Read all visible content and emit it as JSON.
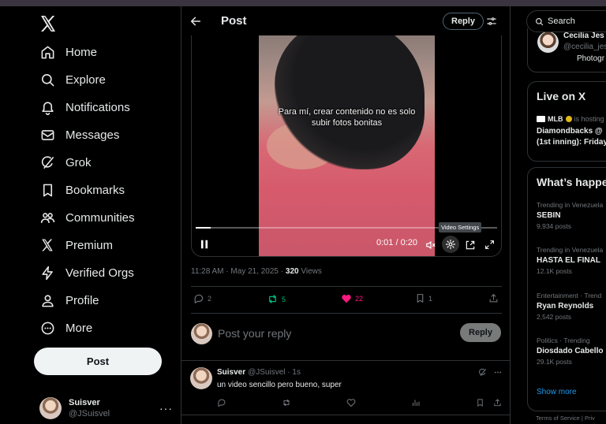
{
  "nav": {
    "items": [
      {
        "label": "Home",
        "icon": "home-icon"
      },
      {
        "label": "Explore",
        "icon": "search-icon"
      },
      {
        "label": "Notifications",
        "icon": "bell-icon"
      },
      {
        "label": "Messages",
        "icon": "envelope-icon"
      },
      {
        "label": "Grok",
        "icon": "grok-icon"
      },
      {
        "label": "Bookmarks",
        "icon": "bookmark-icon"
      },
      {
        "label": "Communities",
        "icon": "people-icon"
      },
      {
        "label": "Premium",
        "icon": "x-logo-icon"
      },
      {
        "label": "Verified Orgs",
        "icon": "lightning-icon"
      },
      {
        "label": "Profile",
        "icon": "person-icon"
      },
      {
        "label": "More",
        "icon": "more-circle-icon"
      }
    ],
    "post_label": "Post",
    "account": {
      "name": "Suisver",
      "handle": "@JSuisvel",
      "menu": "···"
    }
  },
  "header": {
    "title": "Post",
    "reply_label": "Reply"
  },
  "video": {
    "caption_line1": "Para mí, crear contenido no es solo",
    "caption_line2": "subir fotos bonitas",
    "time": "0:01 / 0:20",
    "tooltip": "Video Settings",
    "progress": 0.05
  },
  "post_meta": {
    "time": "11:28 AM · May 21, 2025 · ",
    "views_count": "320",
    "views_label": " Views"
  },
  "actions": {
    "replies": "2",
    "reposts": "5",
    "likes": "22",
    "bookmarks": "1"
  },
  "compose": {
    "placeholder": "Post your reply",
    "button": "Reply"
  },
  "reply": {
    "name": "Suisver",
    "handle": "@JSuisvel · 1s",
    "text": "un video sencillo pero bueno, super"
  },
  "right": {
    "search_placeholder": "Search",
    "suggest": {
      "name": "Cecilia Jes",
      "handle": "@cecilia_jes",
      "extra": "Photogr"
    },
    "live": {
      "title": "Live on X",
      "host": "MLB",
      "host_suffix": " is hosting",
      "line1": "Diamondbacks @",
      "line2": "(1st inning): Friday"
    },
    "trends_title": "What’s happe",
    "trends": [
      {
        "context": "Trending in Venezuela",
        "name": "SEBIN",
        "count": "9,934 posts"
      },
      {
        "context": "Trending in Venezuela",
        "name": "HASTA EL FINAL",
        "count": "12.1K posts"
      },
      {
        "context": "Entertainment · Trend",
        "name": "Ryan Reynolds",
        "count": "2,542 posts"
      },
      {
        "context": "Politics · Trending",
        "name": "Diosdado Cabello",
        "count": "29.1K posts"
      }
    ],
    "show_more": "Show more",
    "footer": "Terms of Service  |  Priv"
  },
  "colors": {
    "accent": "#1d9bf0",
    "like": "#f91880",
    "repost": "#00ba7c",
    "border": "#2f3336"
  }
}
